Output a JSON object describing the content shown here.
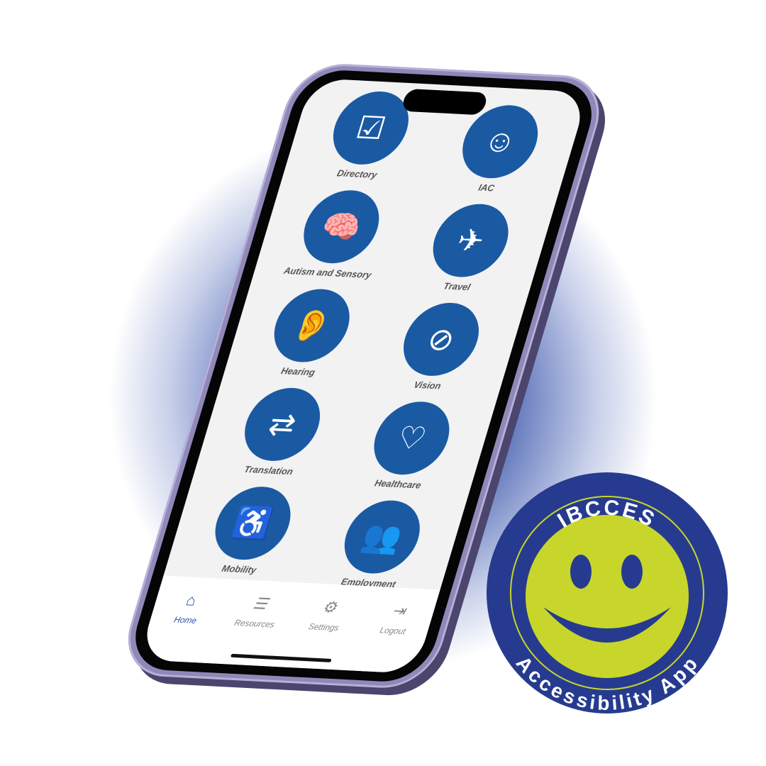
{
  "tiles": [
    {
      "label": "Directory",
      "icon": "clipboard-checklist-icon"
    },
    {
      "label": "IAC",
      "icon": "smiley-icon"
    },
    {
      "label": "Autism and Sensory",
      "icon": "brain-icon"
    },
    {
      "label": "Travel",
      "icon": "airplane-icon"
    },
    {
      "label": "Hearing",
      "icon": "ear-icon"
    },
    {
      "label": "Vision",
      "icon": "eye-slash-icon"
    },
    {
      "label": "Translation",
      "icon": "translation-cards-icon"
    },
    {
      "label": "Healthcare",
      "icon": "heart-hand-icon"
    },
    {
      "label": "Mobility",
      "icon": "wheelchair-ramp-icon"
    },
    {
      "label": "Employment",
      "icon": "people-hands-icon"
    }
  ],
  "tabs": [
    {
      "label": "Home",
      "icon": "home-icon",
      "active": true
    },
    {
      "label": "Resources",
      "icon": "list-icon"
    },
    {
      "label": "Settings",
      "icon": "gear-icon"
    },
    {
      "label": "Logout",
      "icon": "logout-icon"
    }
  ],
  "badge": {
    "top_text": "IBCCES",
    "bottom_text": "Accessibility App"
  },
  "colors": {
    "accent": "#1a5aa3",
    "badge_blue": "#263b8f",
    "smiley_yellow": "#c8d62b",
    "tab_active": "#2c52a8"
  }
}
